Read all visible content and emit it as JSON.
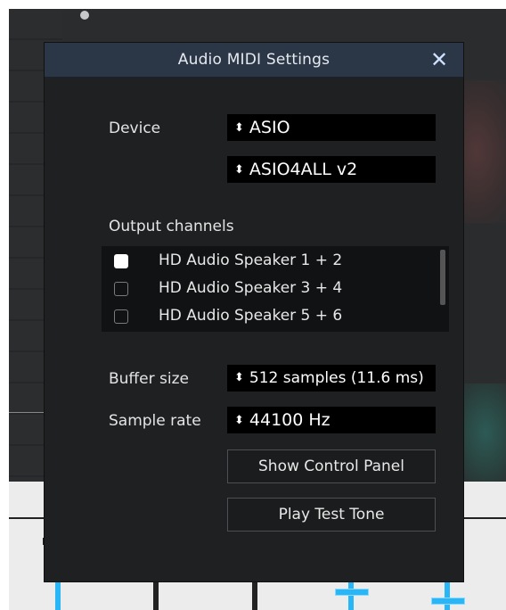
{
  "dialog": {
    "title": "Audio MIDI Settings",
    "close_icon": "close-icon"
  },
  "device": {
    "label": "Device",
    "type_value": "ASIO",
    "device_value": "ASIO4ALL v2"
  },
  "output_channels": {
    "label": "Output channels",
    "items": [
      {
        "label": "HD Audio Speaker 1 + 2",
        "checked": true
      },
      {
        "label": "HD Audio Speaker 3 + 4",
        "checked": false
      },
      {
        "label": "HD Audio Speaker 5 + 6",
        "checked": false
      }
    ]
  },
  "buffer": {
    "label": "Buffer size",
    "value": "512 samples (11.6 ms)"
  },
  "sample_rate": {
    "label": "Sample rate",
    "value": "44100 Hz"
  },
  "buttons": {
    "control_panel": "Show Control Panel",
    "test_tone": "Play Test Tone"
  },
  "combo_arrow": "⬍",
  "colors": {
    "titlebar": "#2b3747",
    "accent": "#29b6f6"
  }
}
